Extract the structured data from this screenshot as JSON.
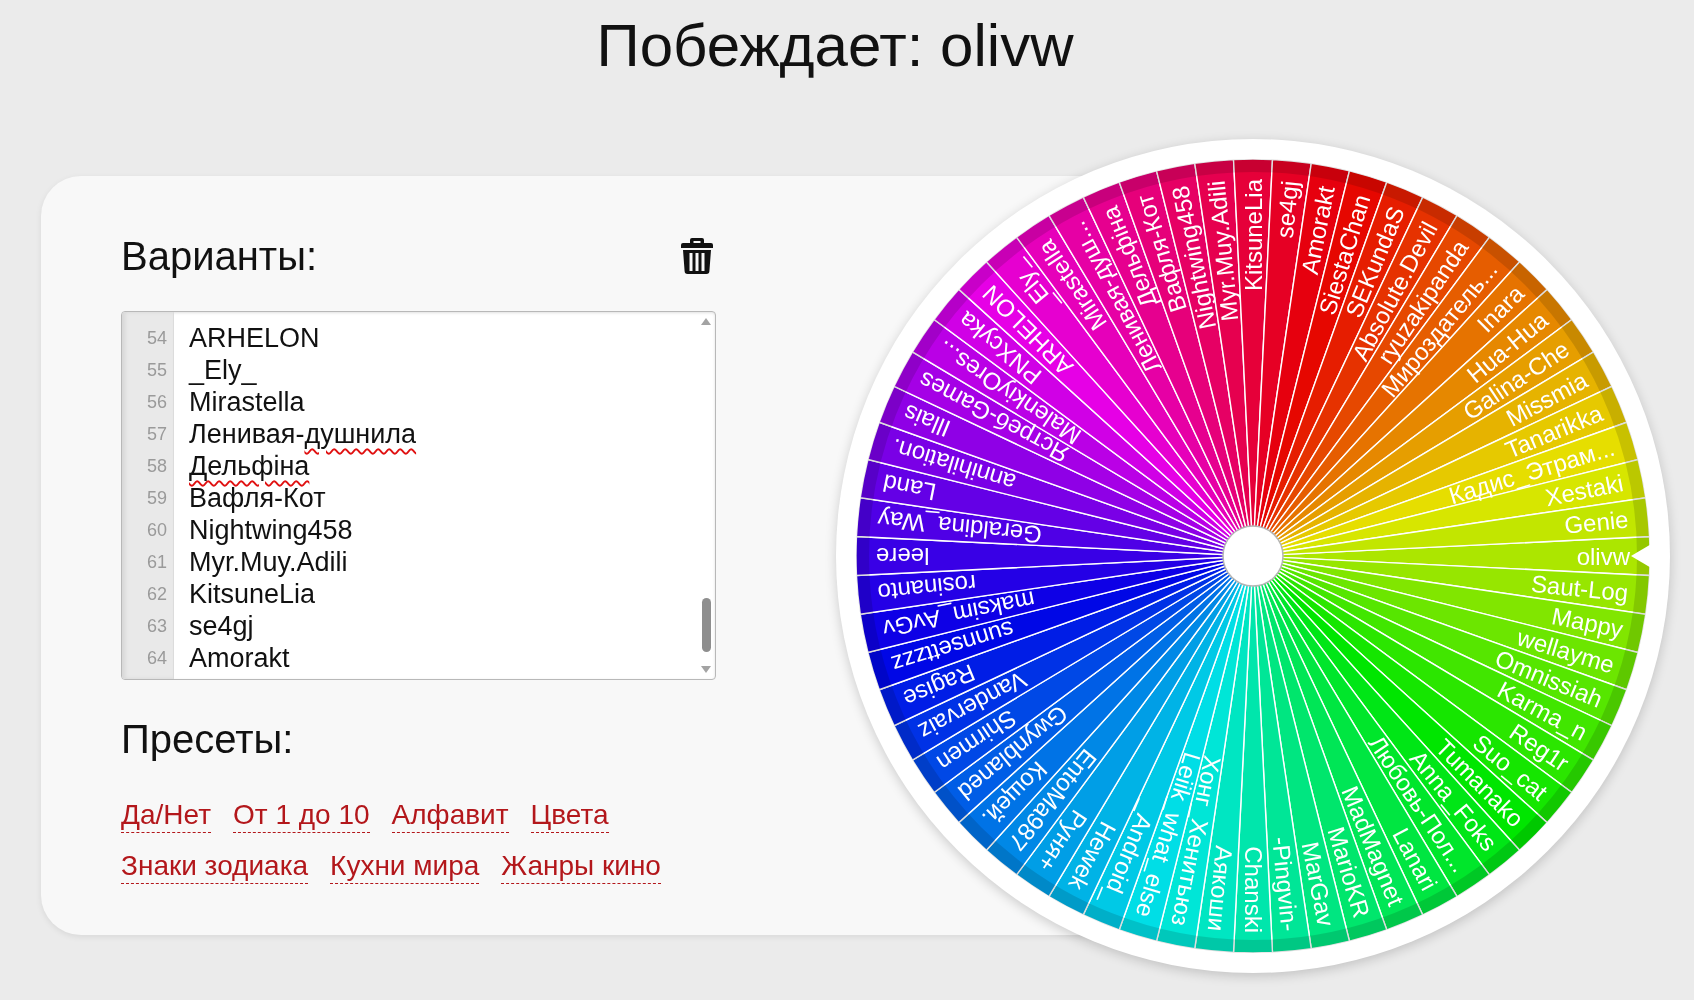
{
  "title": "Побеждает: olivw",
  "options": {
    "heading": "Варианты:",
    "lines": [
      {
        "number": "54",
        "parts": [
          {
            "text": "ARHELON",
            "misspelled": false
          }
        ]
      },
      {
        "number": "55",
        "parts": [
          {
            "text": "_Ely_",
            "misspelled": false
          }
        ]
      },
      {
        "number": "56",
        "parts": [
          {
            "text": "Mirastella",
            "misspelled": false
          }
        ]
      },
      {
        "number": "57",
        "parts": [
          {
            "text": "Ленивая-",
            "misspelled": false
          },
          {
            "text": "душнила",
            "misspelled": true
          }
        ]
      },
      {
        "number": "58",
        "parts": [
          {
            "text": "Дельфіна",
            "misspelled": true
          }
        ]
      },
      {
        "number": "59",
        "parts": [
          {
            "text": "Вафля-Кот",
            "misspelled": false
          }
        ]
      },
      {
        "number": "60",
        "parts": [
          {
            "text": "Nightwing458",
            "misspelled": false
          }
        ]
      },
      {
        "number": "61",
        "parts": [
          {
            "text": "Myr.Muy.Adili",
            "misspelled": false
          }
        ]
      },
      {
        "number": "62",
        "parts": [
          {
            "text": "KitsuneLia",
            "misspelled": false
          }
        ]
      },
      {
        "number": "63",
        "parts": [
          {
            "text": "se4gj",
            "misspelled": false
          }
        ]
      },
      {
        "number": "64",
        "parts": [
          {
            "text": "Amorakt",
            "misspelled": false
          }
        ]
      }
    ]
  },
  "presets": {
    "heading": "Пресеты:",
    "items": [
      "Да/Нет",
      "От 1 до 10",
      "Алфавит",
      "Цвета",
      "Знаки зодиака",
      "Кухни мира",
      "Жанры кино"
    ]
  },
  "wheel": {
    "segments": [
      "olivw",
      "Saut-Log",
      "Mappy",
      "wellayme",
      "Omnissiah",
      "Karma_n",
      "Reg1r",
      "Suo_cat",
      "Tumanako",
      "Anna_Foks",
      "Любовь-Пол...",
      "Lanari",
      "MadMagnet",
      "MarioKR",
      "MarGav",
      "-Pingvin-",
      "Chanski",
      "Аякоши",
      "Хонг_Хенитьюз",
      "Leiik_what_else",
      "_Android_",
      "Hewek",
      "Руня+",
      "EntoMa987",
      "Кощей.",
      "Gwynblaned",
      "Shirmen",
      "Vandervaiz",
      "Ragise",
      "sunnsettzzz",
      "maksim_AvGv",
      "rosinanto",
      "leere",
      "Geraldina_Way",
      "Land",
      "annihilation.",
      "Illais",
      "Ястреб-Games",
      "MalenkiyOres...",
      "PNXcyka",
      "ARHELON",
      "_Ely_",
      "Mirastella",
      "Ленивая-душ...",
      "Дельфіна",
      "Вафля-Кот",
      "Nightwing458",
      "Myr.Muy.Adili",
      "KitsuneLia",
      "se4gj",
      "Amorakt",
      "SiestaChan",
      "SEKundaS",
      "Absolute.Devil",
      "ryuzakipanda",
      "Мироздатель...",
      "Inara",
      "Hua-Hua",
      "Galina-Che",
      "Missmia",
      "Tanarikka",
      "Кадис_Этрам...",
      "Xestaki",
      "Genie"
    ]
  }
}
